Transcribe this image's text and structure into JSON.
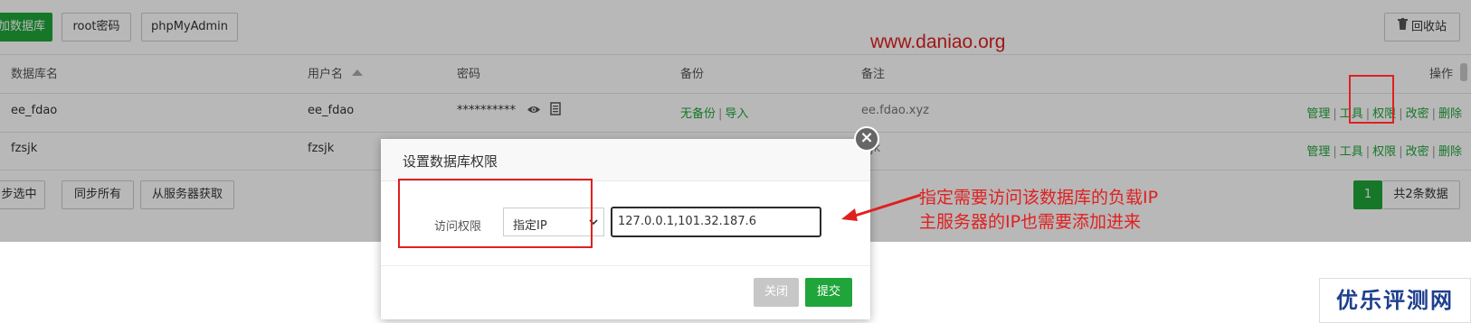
{
  "toolbar": {
    "add_db": "加数据库",
    "root_password": "root密码",
    "phpmyadmin": "phpMyAdmin",
    "recycle_bin": "回收站"
  },
  "watermark_url": "www.daniao.org",
  "table": {
    "headers": {
      "name": "数据库名",
      "user": "用户名",
      "password": "密码",
      "backup": "备份",
      "note": "备注",
      "ops": "操作"
    },
    "rows": [
      {
        "name": "ee_fdao",
        "user": "ee_fdao",
        "password": "**********",
        "backup_none": "无备份",
        "backup_import": "导入",
        "note": "ee.fdao.xyz",
        "ops": [
          "管理",
          "工具",
          "权限",
          "改密",
          "删除"
        ]
      },
      {
        "name": "fzsjk",
        "user": "fzsjk",
        "note": "jk",
        "ops": [
          "管理",
          "工具",
          "权限",
          "改密",
          "删除"
        ]
      }
    ]
  },
  "sync": {
    "selected": "步选中",
    "all": "同步所有",
    "from_server": "从服务器获取"
  },
  "pagination": {
    "current": "1",
    "total": "共2条数据"
  },
  "modal": {
    "title": "设置数据库权限",
    "label": "访问权限",
    "select_value": "指定IP",
    "ip_value": "127.0.0.1,101.32.187.6",
    "close_label": "关闭",
    "submit_label": "提交"
  },
  "annotation": {
    "line1": "指定需要访问该数据库的负载IP",
    "line2": "主服务器的IP也需要添加进来"
  },
  "brand_watermark": "优乐评测网",
  "colors": {
    "accent_green": "#20a53a",
    "annotation_red": "#e02020",
    "watermark_blue": "#1e3f8f"
  }
}
